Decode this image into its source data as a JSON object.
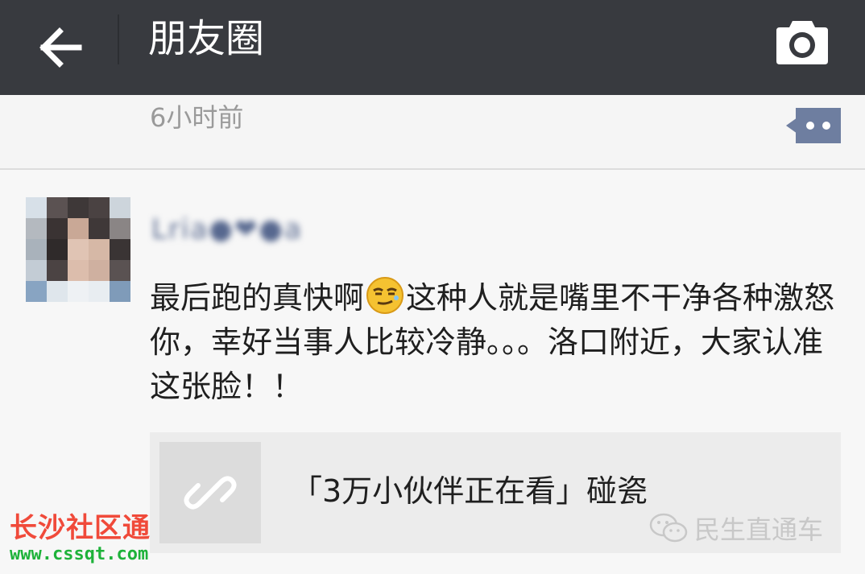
{
  "header": {
    "title": "朋友圈",
    "back_icon": "back-arrow-icon",
    "camera_icon": "camera-icon"
  },
  "previous_post": {
    "timestamp": "6小时前",
    "comment_icon": "comment-more-icon"
  },
  "post": {
    "username": "Lria●❤●a",
    "text_before_emoji": "最后跑的真快啊",
    "emoji": "smirk-emoji",
    "text_after_emoji": "这种人就是嘴里不干净各种激怒你，幸好当事人比较冷静。。。洛口附近，大家认准这张脸！！",
    "share": {
      "title": "「3万小伙伴正在看」碰瓷",
      "link_icon": "link-icon"
    }
  },
  "watermarks": {
    "left_brand": "长沙社区通",
    "left_url": "www.cssqt.com",
    "right_source": "民生直通车"
  },
  "colors": {
    "topbar": "#383a3f",
    "username": "#57688f",
    "brand_red": "#f04a3a",
    "brand_green": "#1eb23a"
  }
}
